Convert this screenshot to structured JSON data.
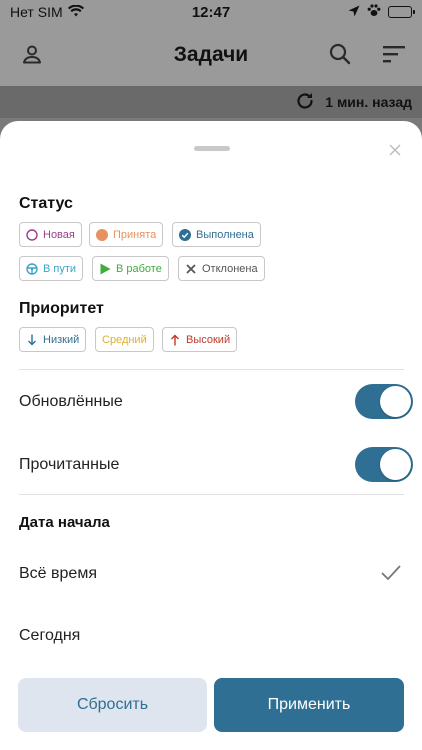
{
  "status_bar": {
    "carrier": "Нет SIM",
    "time": "12:47"
  },
  "nav": {
    "title": "Задачи"
  },
  "refresh": {
    "text": "1 мин. назад"
  },
  "filters": {
    "status": {
      "title": "Статус",
      "chips": [
        {
          "label": "Новая",
          "icon": "circle-outline-icon",
          "color": "#9b3f8f"
        },
        {
          "label": "Принята",
          "icon": "circle-filled-icon",
          "color": "#e8915e"
        },
        {
          "label": "Выполнена",
          "icon": "check-circle-icon",
          "color": "#2e6f93"
        },
        {
          "label": "В пути",
          "icon": "steering-wheel-icon",
          "color": "#3aa4c9"
        },
        {
          "label": "В работе",
          "icon": "play-icon",
          "color": "#3fae3a"
        },
        {
          "label": "Отклонена",
          "icon": "x-icon",
          "color": "#555555"
        }
      ]
    },
    "priority": {
      "title": "Приоритет",
      "chips": [
        {
          "label": "Низкий",
          "icon": "arrow-down-icon",
          "color": "#2e6f93"
        },
        {
          "label": "Средний",
          "icon": "",
          "color": "#e0b02a"
        },
        {
          "label": "Высокий",
          "icon": "arrow-up-icon",
          "color": "#c0392b"
        }
      ]
    },
    "toggles": [
      {
        "label": "Обновлённые",
        "on": true
      },
      {
        "label": "Прочитанные",
        "on": true
      }
    ],
    "start_date": {
      "title": "Дата начала",
      "options": [
        {
          "label": "Всё время",
          "selected": true
        },
        {
          "label": "Сегодня",
          "selected": false
        }
      ]
    }
  },
  "actions": {
    "reset": "Сбросить",
    "apply": "Применить"
  },
  "colors": {
    "accent": "#2e6f93",
    "secondary_bg": "#dfe5ee"
  }
}
